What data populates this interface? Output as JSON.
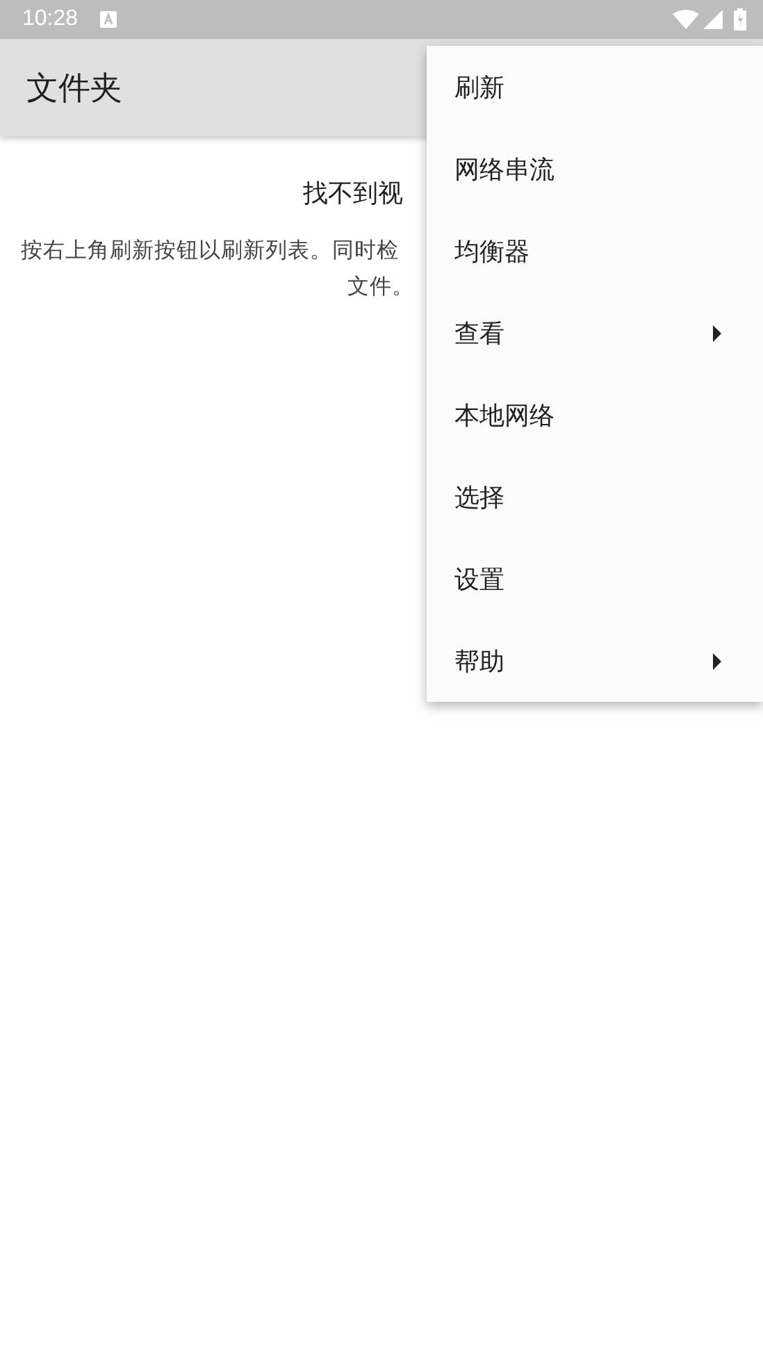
{
  "status_bar": {
    "time": "10:28"
  },
  "toolbar": {
    "title": "文件夹"
  },
  "empty_state": {
    "title": "找不到视",
    "message_lines": [
      "按右上角刷新按钮以刷新列表。同时检",
      "文件。"
    ]
  },
  "menu": {
    "items": [
      {
        "label": "刷新",
        "submenu": false
      },
      {
        "label": "网络串流",
        "submenu": false
      },
      {
        "label": "均衡器",
        "submenu": false
      },
      {
        "label": "查看",
        "submenu": true
      },
      {
        "label": "本地网络",
        "submenu": false
      },
      {
        "label": "选择",
        "submenu": false
      },
      {
        "label": "设置",
        "submenu": false
      },
      {
        "label": "帮助",
        "submenu": true
      }
    ]
  }
}
